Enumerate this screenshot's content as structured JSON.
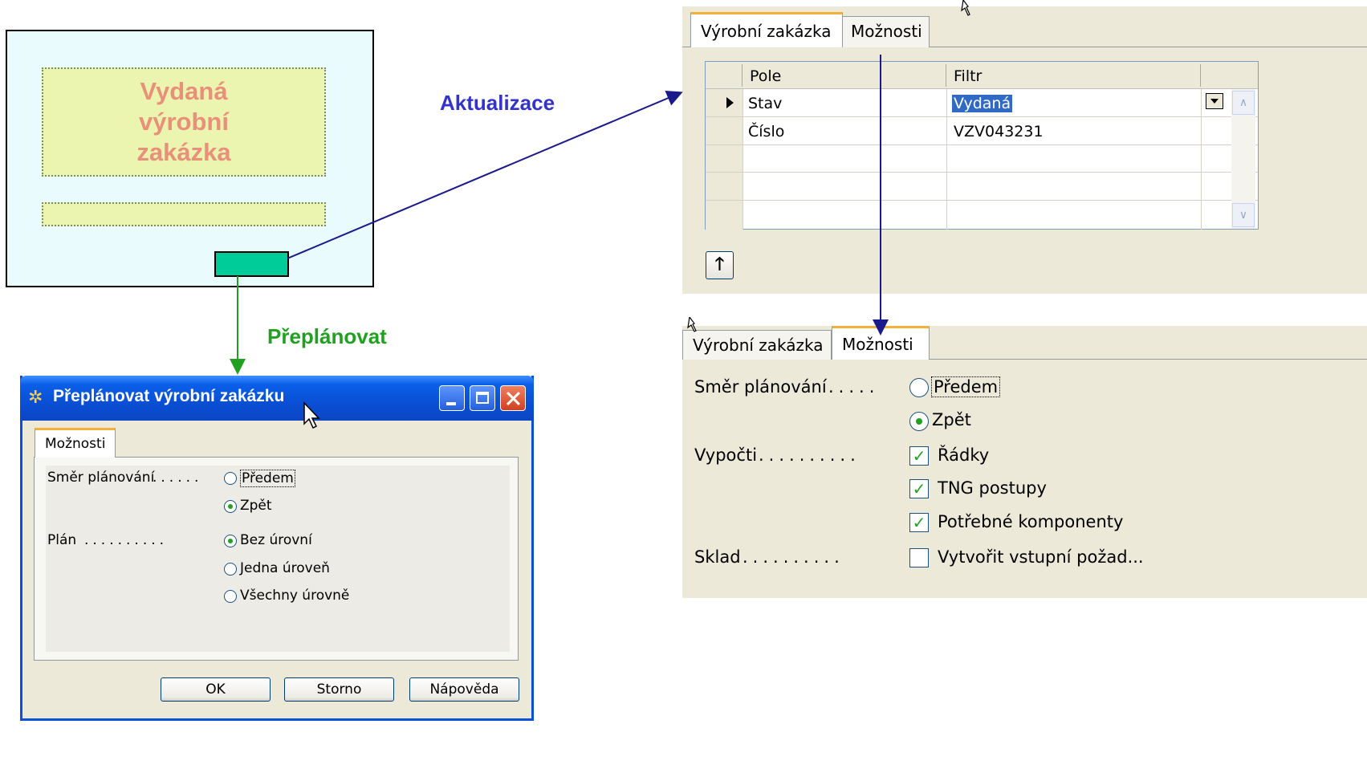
{
  "diagram": {
    "card_title": "Vydaná\nvýrobní\nzakázka",
    "label_update": "Aktualizace",
    "label_replan": "Přeplánovat"
  },
  "dialog": {
    "title": "Přeplánovat výrobní zakázku",
    "tab": "Možnosti",
    "direction_label": "Směr plánování",
    "direction_dots": "......",
    "direction_options": [
      "Předem",
      "Zpět"
    ],
    "direction_selected": "Zpět",
    "plan_label": "Plán",
    "plan_dots": "..........",
    "plan_options": [
      "Bez úrovní",
      "Jedna úroveň",
      "Všechny úrovně"
    ],
    "plan_selected": "Bez úrovní",
    "buttons": {
      "ok": "OK",
      "cancel": "Storno",
      "help": "Nápověda"
    }
  },
  "filter_panel": {
    "tabs": [
      "Výrobní zakázka",
      "Možnosti"
    ],
    "active_tab": "Výrobní zakázka",
    "columns": [
      "Pole",
      "Filtr"
    ],
    "rows": [
      {
        "field": "Stav",
        "filter": "Vydaná"
      },
      {
        "field": "Číslo",
        "filter": "VZV043231"
      }
    ]
  },
  "options_panel": {
    "tabs": [
      "Výrobní zakázka",
      "Možnosti"
    ],
    "active_tab": "Možnosti",
    "direction_label": "Směr plánování",
    "direction_dots": ".....",
    "direction_options": [
      "Předem",
      "Zpět"
    ],
    "direction_selected": "Zpět",
    "calc_label": "Vypočti",
    "calc_dots": "..........",
    "calc_options": [
      "Řádky",
      "TNG postupy",
      "Potřebné komponenty"
    ],
    "warehouse_label": "Sklad",
    "warehouse_dots": "..........",
    "warehouse_option": "Vytvořit vstupní požad..."
  },
  "colors": {
    "update_label": "#3333cc",
    "replan_label": "#21a021",
    "card_button": "#00cc99",
    "xp_titlebar": "#0a50d8"
  }
}
